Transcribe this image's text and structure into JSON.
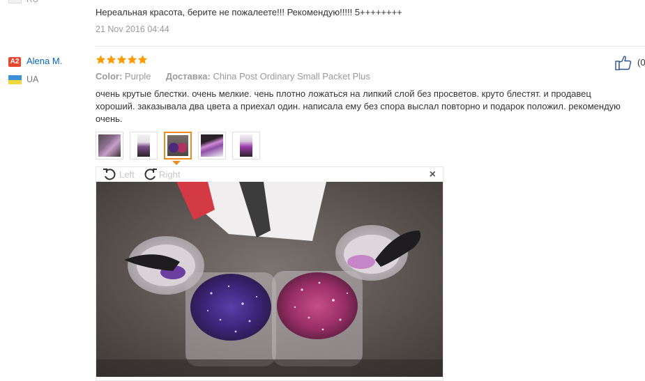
{
  "previous_review": {
    "country_code": "RU",
    "text": "Нереальная красота, берите не пожалеете!!! Рекомендую!!!!! 5++++++++",
    "date": "21 Nov 2016 04:44"
  },
  "review": {
    "user_badge": "A2",
    "user_name": "Alena M.",
    "country_code": "UA",
    "rating_stars": 5,
    "color_label": "Color:",
    "color_value": "Purple",
    "delivery_label": "Доставка:",
    "delivery_value": "China Post Ordinary Small Packet Plus",
    "like_count": "(0",
    "text_lines": [
      "очень крутые блестки. очень мелкие. чень плотно ложаться на липкий слой без просветов. круто блестят. и продавец",
      "хороший. заказывала два цвета а приехал один. написала ему без спора выслал повторно и подарок положил. рекомендую",
      "очень."
    ]
  },
  "viewer": {
    "rotate_left_label": "Left",
    "rotate_right_label": "Right",
    "close_label": "×",
    "selected_thumbnail_index": 2
  },
  "colors": {
    "link": "#0066c0",
    "star": "#ff9a00",
    "badge": "#e8462f",
    "active_border": "#f0891e",
    "flag_ua_top": "#3d8fd6",
    "flag_ua_bottom": "#f3d63a"
  }
}
